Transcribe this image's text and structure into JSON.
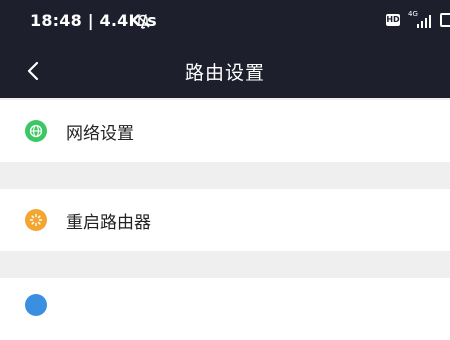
{
  "status_bar": {
    "time_speed": "18:48 | 4.4K/s",
    "hd_badge": "HD",
    "network_label": "4G"
  },
  "nav": {
    "title": "路由设置"
  },
  "menu": {
    "items": [
      {
        "label": "网络设置",
        "icon": "globe-icon",
        "color": "#3cc764"
      },
      {
        "label": "重启路由器",
        "icon": "restart-icon",
        "color": "#f3a531"
      },
      {
        "label": "",
        "icon": "circle-icon",
        "color": "#3b8fe0"
      }
    ]
  }
}
